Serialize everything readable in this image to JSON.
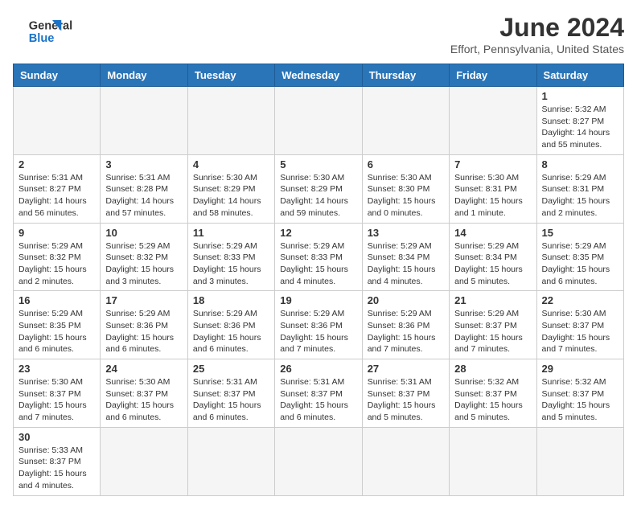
{
  "header": {
    "logo_line1": "General",
    "logo_line2": "Blue",
    "month_year": "June 2024",
    "location": "Effort, Pennsylvania, United States"
  },
  "weekdays": [
    "Sunday",
    "Monday",
    "Tuesday",
    "Wednesday",
    "Thursday",
    "Friday",
    "Saturday"
  ],
  "weeks": [
    [
      {
        "day": "",
        "info": ""
      },
      {
        "day": "",
        "info": ""
      },
      {
        "day": "",
        "info": ""
      },
      {
        "day": "",
        "info": ""
      },
      {
        "day": "",
        "info": ""
      },
      {
        "day": "",
        "info": ""
      },
      {
        "day": "1",
        "info": "Sunrise: 5:32 AM\nSunset: 8:27 PM\nDaylight: 14 hours and 55 minutes."
      }
    ],
    [
      {
        "day": "2",
        "info": "Sunrise: 5:31 AM\nSunset: 8:27 PM\nDaylight: 14 hours and 56 minutes."
      },
      {
        "day": "3",
        "info": "Sunrise: 5:31 AM\nSunset: 8:28 PM\nDaylight: 14 hours and 57 minutes."
      },
      {
        "day": "4",
        "info": "Sunrise: 5:30 AM\nSunset: 8:29 PM\nDaylight: 14 hours and 58 minutes."
      },
      {
        "day": "5",
        "info": "Sunrise: 5:30 AM\nSunset: 8:29 PM\nDaylight: 14 hours and 59 minutes."
      },
      {
        "day": "6",
        "info": "Sunrise: 5:30 AM\nSunset: 8:30 PM\nDaylight: 15 hours and 0 minutes."
      },
      {
        "day": "7",
        "info": "Sunrise: 5:30 AM\nSunset: 8:31 PM\nDaylight: 15 hours and 1 minute."
      },
      {
        "day": "8",
        "info": "Sunrise: 5:29 AM\nSunset: 8:31 PM\nDaylight: 15 hours and 2 minutes."
      }
    ],
    [
      {
        "day": "9",
        "info": "Sunrise: 5:29 AM\nSunset: 8:32 PM\nDaylight: 15 hours and 2 minutes."
      },
      {
        "day": "10",
        "info": "Sunrise: 5:29 AM\nSunset: 8:32 PM\nDaylight: 15 hours and 3 minutes."
      },
      {
        "day": "11",
        "info": "Sunrise: 5:29 AM\nSunset: 8:33 PM\nDaylight: 15 hours and 3 minutes."
      },
      {
        "day": "12",
        "info": "Sunrise: 5:29 AM\nSunset: 8:33 PM\nDaylight: 15 hours and 4 minutes."
      },
      {
        "day": "13",
        "info": "Sunrise: 5:29 AM\nSunset: 8:34 PM\nDaylight: 15 hours and 4 minutes."
      },
      {
        "day": "14",
        "info": "Sunrise: 5:29 AM\nSunset: 8:34 PM\nDaylight: 15 hours and 5 minutes."
      },
      {
        "day": "15",
        "info": "Sunrise: 5:29 AM\nSunset: 8:35 PM\nDaylight: 15 hours and 6 minutes."
      }
    ],
    [
      {
        "day": "16",
        "info": "Sunrise: 5:29 AM\nSunset: 8:35 PM\nDaylight: 15 hours and 6 minutes."
      },
      {
        "day": "17",
        "info": "Sunrise: 5:29 AM\nSunset: 8:36 PM\nDaylight: 15 hours and 6 minutes."
      },
      {
        "day": "18",
        "info": "Sunrise: 5:29 AM\nSunset: 8:36 PM\nDaylight: 15 hours and 6 minutes."
      },
      {
        "day": "19",
        "info": "Sunrise: 5:29 AM\nSunset: 8:36 PM\nDaylight: 15 hours and 7 minutes."
      },
      {
        "day": "20",
        "info": "Sunrise: 5:29 AM\nSunset: 8:36 PM\nDaylight: 15 hours and 7 minutes."
      },
      {
        "day": "21",
        "info": "Sunrise: 5:29 AM\nSunset: 8:37 PM\nDaylight: 15 hours and 7 minutes."
      },
      {
        "day": "22",
        "info": "Sunrise: 5:30 AM\nSunset: 8:37 PM\nDaylight: 15 hours and 7 minutes."
      }
    ],
    [
      {
        "day": "23",
        "info": "Sunrise: 5:30 AM\nSunset: 8:37 PM\nDaylight: 15 hours and 7 minutes."
      },
      {
        "day": "24",
        "info": "Sunrise: 5:30 AM\nSunset: 8:37 PM\nDaylight: 15 hours and 6 minutes."
      },
      {
        "day": "25",
        "info": "Sunrise: 5:31 AM\nSunset: 8:37 PM\nDaylight: 15 hours and 6 minutes."
      },
      {
        "day": "26",
        "info": "Sunrise: 5:31 AM\nSunset: 8:37 PM\nDaylight: 15 hours and 6 minutes."
      },
      {
        "day": "27",
        "info": "Sunrise: 5:31 AM\nSunset: 8:37 PM\nDaylight: 15 hours and 5 minutes."
      },
      {
        "day": "28",
        "info": "Sunrise: 5:32 AM\nSunset: 8:37 PM\nDaylight: 15 hours and 5 minutes."
      },
      {
        "day": "29",
        "info": "Sunrise: 5:32 AM\nSunset: 8:37 PM\nDaylight: 15 hours and 5 minutes."
      }
    ],
    [
      {
        "day": "30",
        "info": "Sunrise: 5:33 AM\nSunset: 8:37 PM\nDaylight: 15 hours and 4 minutes."
      },
      {
        "day": "",
        "info": ""
      },
      {
        "day": "",
        "info": ""
      },
      {
        "day": "",
        "info": ""
      },
      {
        "day": "",
        "info": ""
      },
      {
        "day": "",
        "info": ""
      },
      {
        "day": "",
        "info": ""
      }
    ]
  ]
}
